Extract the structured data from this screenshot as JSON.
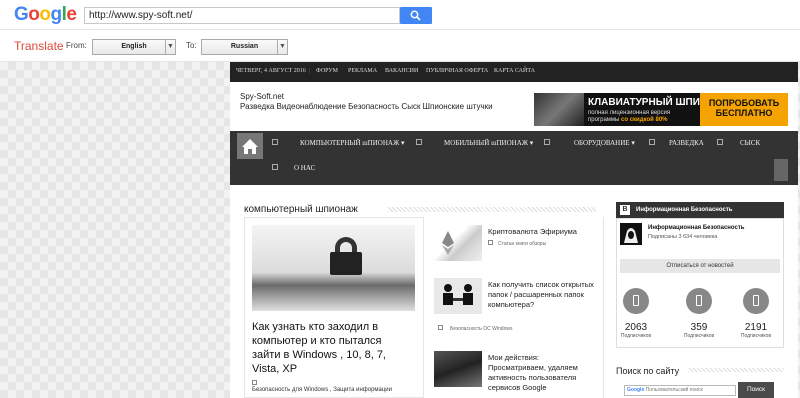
{
  "google": {
    "logo": "Google",
    "url_value": "http://www.spy-soft.net/",
    "translate_label": "Translate",
    "from_label": "From:",
    "from_value": "English",
    "to_label": "To:",
    "to_value": "Russian"
  },
  "site": {
    "topnav": [
      "ЧЕТВЕРГ, 4 АВГУСТ 2016",
      "ФОРУМ",
      "РЕКЛАМА",
      "ВАКАНСИИ",
      "ПУБЛИЧНАЯ ОФЕРТА",
      "КАРТА САЙТА"
    ],
    "title": "Spy-Soft.net",
    "subtitle": "Разведка Видеонаблюдение Безопасность Сыск Шпионские штучки",
    "banner": {
      "line1": "КЛАВИАТУРНЫЙ ШПИОН",
      "line2a": "полная лицензионная версия",
      "line2b": "программы",
      "discount": "со скидкой 80%",
      "cta": "ПОПРОБОВАТЬ БЕСПЛАТНО"
    },
    "menu": [
      "КОМПЬЮТЕРНЫЙ шПИОНАЖ",
      "МОБИЛЬНЫЙ шПИОНАЖ",
      "ОБОРУДОВАНИЕ",
      "РАЗВЕДКА",
      "СЫСК",
      "О НАС"
    ],
    "section_heading": "компьютерный шпионаж",
    "featured": {
      "title": "Как узнать кто заходил в компьютер и кто пытался зайти в Windows , 10, 8, 7, Vista, XP",
      "meta": "Безопасность    для Windows , Защита информации"
    },
    "articles": [
      {
        "title": "Криптовалюта Эфириума",
        "meta": "Статьи книги обзоры"
      },
      {
        "title": "Как получить список открытых папок / расшаренных папок компьютера?",
        "meta": "Безопасность ОС Windows"
      },
      {
        "title": "Мои действия: Просматриваем, удаляем активность пользователя сервисов Google",
        "meta": ""
      }
    ],
    "vk": {
      "badge": "B",
      "header": "Информационная Безопасность",
      "name": "Информационная Безопасность",
      "subs": "Подписаны 3 634 человека",
      "unsubscribe": "Отписаться от новостей"
    },
    "stats": [
      {
        "num": "2063",
        "label": "Подписчиков"
      },
      {
        "num": "359",
        "label": "Подписчиков"
      },
      {
        "num": "2191",
        "label": "Подписчиков"
      }
    ],
    "search_heading": "Поиск по сайту",
    "search_placeholder_brand": "Google",
    "search_placeholder": "Пользовательский поиск",
    "search_button": "Поиск"
  }
}
